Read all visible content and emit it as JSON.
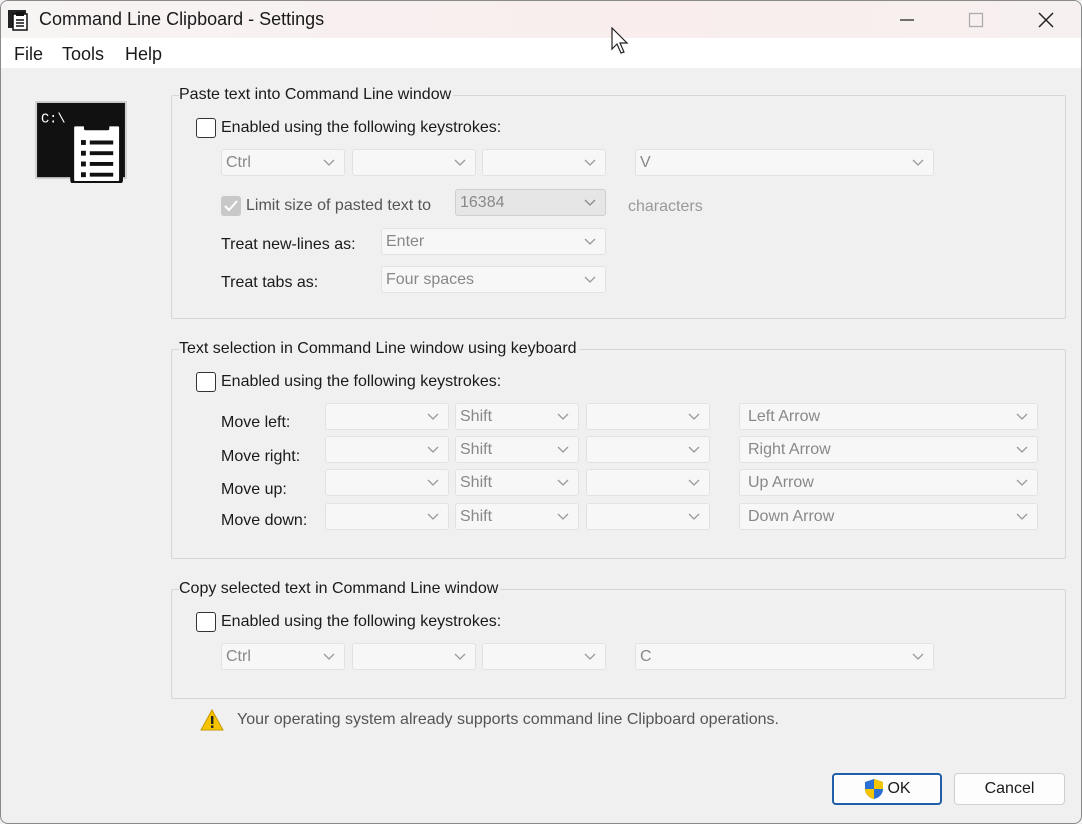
{
  "window": {
    "title": "Command Line Clipboard - Settings",
    "controls": [
      "minimize-icon",
      "maximize-icon",
      "close-icon"
    ]
  },
  "menu": {
    "file": "File",
    "tools": "Tools",
    "help": "Help"
  },
  "paste_group": {
    "title": "Paste text into Command Line window",
    "enable_label": "Enabled using the following keystrokes:",
    "enabled": false,
    "key1": "Ctrl",
    "key2": "",
    "key3": "",
    "key4": "V",
    "limit_label": "Limit size of pasted text to",
    "limit_checked": true,
    "limit_value": "16384",
    "limit_unit": "characters",
    "newlines_label": "Treat new-lines as:",
    "newlines_value": "Enter",
    "tabs_label": "Treat tabs as:",
    "tabs_value": "Four spaces"
  },
  "selection_group": {
    "title": "Text selection in Command Line window using keyboard",
    "enable_label": "Enabled using the following keystrokes:",
    "enabled": false,
    "rows": [
      {
        "label": "Move left:",
        "k1": "",
        "k2": "Shift",
        "k3": "",
        "k4": "Left Arrow"
      },
      {
        "label": "Move right:",
        "k1": "",
        "k2": "Shift",
        "k3": "",
        "k4": "Right Arrow"
      },
      {
        "label": "Move up:",
        "k1": "",
        "k2": "Shift",
        "k3": "",
        "k4": "Up Arrow"
      },
      {
        "label": "Move down:",
        "k1": "",
        "k2": "Shift",
        "k3": "",
        "k4": "Down Arrow"
      }
    ]
  },
  "copy_group": {
    "title": "Copy selected text in Command Line window",
    "enable_label": "Enabled using the following keystrokes:",
    "enabled": false,
    "key1": "Ctrl",
    "key2": "",
    "key3": "",
    "key4": "C"
  },
  "warning": {
    "text": "Your operating system already supports command line Clipboard operations.",
    "icon": "warning-icon"
  },
  "buttons": {
    "ok": "OK",
    "cancel": "Cancel"
  },
  "colors": {
    "default_button_border": "#1f5ea8",
    "warning_yellow": "#f5c400"
  }
}
